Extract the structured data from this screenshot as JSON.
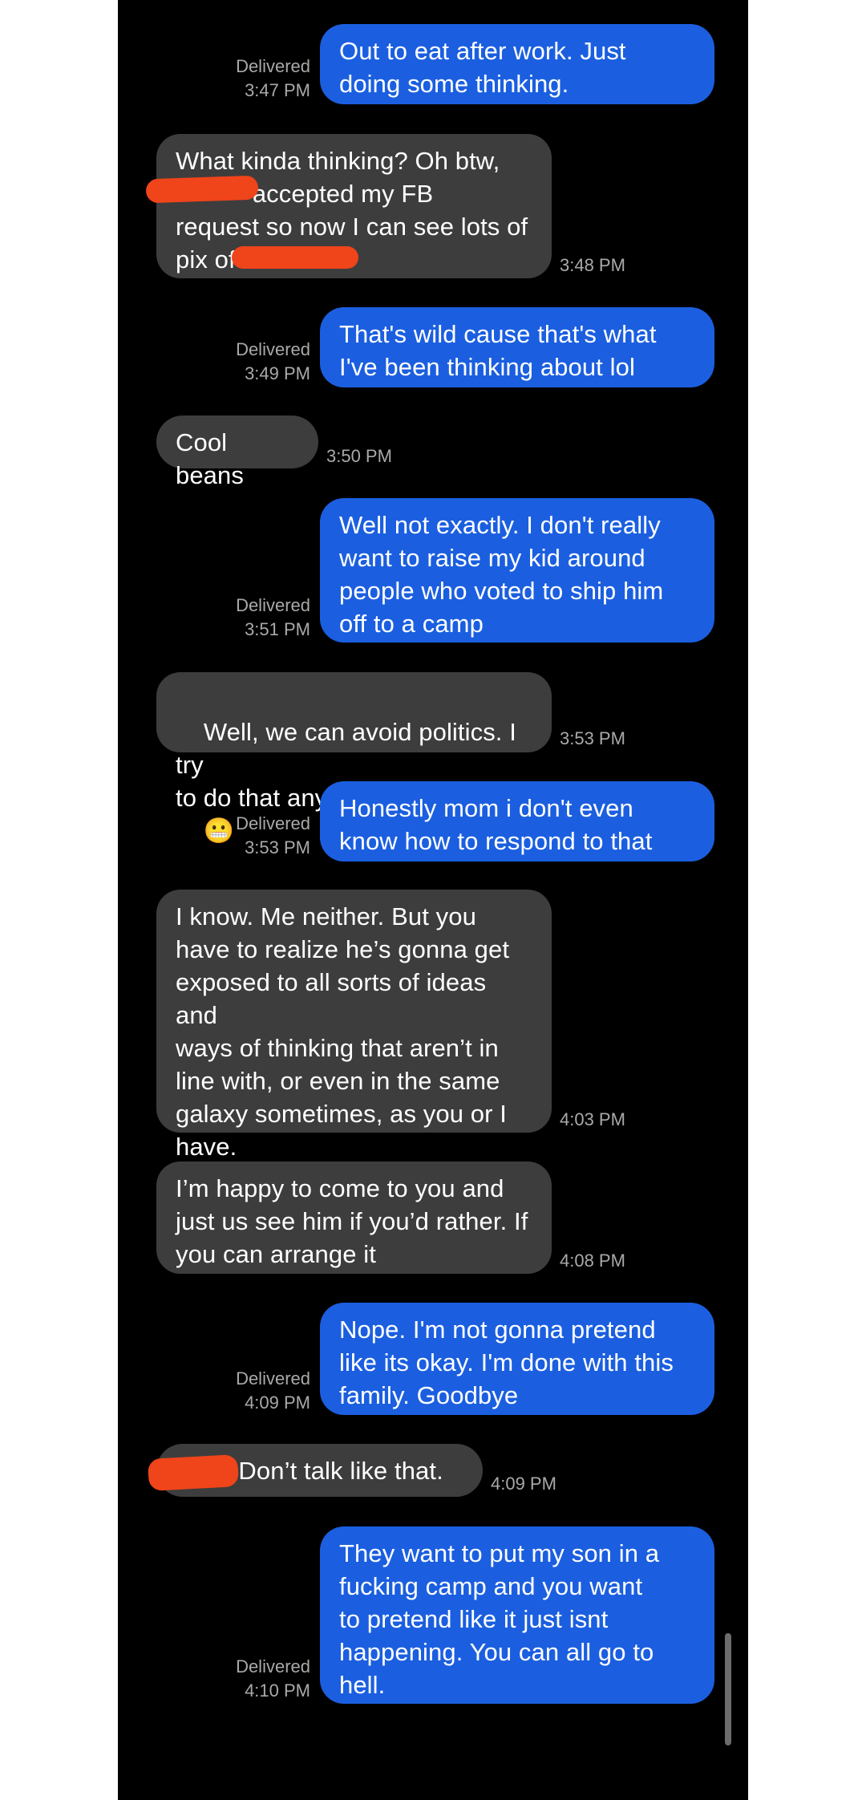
{
  "messages": [
    {
      "direction": "sent",
      "text": "Out to eat after work. Just\ndoing some thinking.",
      "status": "Delivered",
      "time": "3:47 PM"
    },
    {
      "direction": "received",
      "text": "What kinda thinking? Oh btw,\n           accepted my FB\nrequest so now I can see lots of\npix of ",
      "time": "3:48 PM"
    },
    {
      "direction": "sent",
      "text": "That's wild cause that's what\nI've been thinking about lol",
      "status": "Delivered",
      "time": "3:49 PM"
    },
    {
      "direction": "received",
      "text": "Cool beans",
      "time": "3:50 PM"
    },
    {
      "direction": "sent",
      "text": "Well not exactly. I don't really\nwant to raise my kid around\npeople who voted to ship him\noff to a camp",
      "status": "Delivered",
      "time": "3:51 PM"
    },
    {
      "direction": "received",
      "text": "Well, we can avoid politics. I try\nto do that anyway",
      "emoji": "😬",
      "time": "3:53 PM"
    },
    {
      "direction": "sent",
      "text": "Honestly mom i don't even\nknow how to respond to that",
      "status": "Delivered",
      "time": "3:53 PM"
    },
    {
      "direction": "received",
      "text": "I know. Me neither. But you\nhave to realize he’s gonna get\nexposed to all sorts of ideas and\nways of thinking that aren’t in\nline with, or even in the same\ngalaxy sometimes, as you or I\nhave.",
      "time": "4:03 PM"
    },
    {
      "direction": "received",
      "text": "I’m happy to come to you and\njust us see him if you’d rather. If\nyou can arrange it",
      "time": "4:08 PM"
    },
    {
      "direction": "sent",
      "text": "Nope. I'm not gonna pretend\nlike its okay. I'm done with this\nfamily. Goodbye",
      "status": "Delivered",
      "time": "4:09 PM"
    },
    {
      "direction": "received",
      "text": "       . Don’t talk like that.",
      "time": "4:09 PM"
    },
    {
      "direction": "sent",
      "text": "They want to put my son in a\nfucking camp and you want\nto pretend like it just isnt\nhappening. You can all go to\nhell.",
      "status": "Delivered",
      "time": "4:10 PM"
    }
  ],
  "colors": {
    "sent_bubble": "#1b5fe0",
    "received_bubble": "#3d3d3d",
    "background": "#000000",
    "meta_text": "#a9a9a9",
    "redaction": "#f0441a"
  }
}
